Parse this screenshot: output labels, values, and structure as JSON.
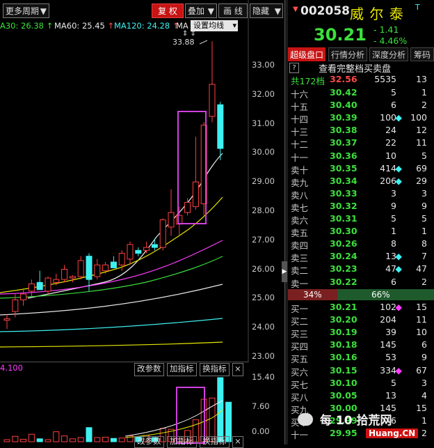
{
  "toolbar": {
    "period_label": "更多周期",
    "adjust_label": "复 权",
    "overlay_label": "叠加",
    "draw_label": "画 线",
    "hide_label": "隐藏",
    "set_ma_label": "设置均线"
  },
  "ma_legend": [
    {
      "label": "A30: 26.38",
      "arrow": "↑",
      "color": "#3be03b"
    },
    {
      "label": "MA60: 25.45",
      "arrow": "↑",
      "color": "#e8e8e8"
    },
    {
      "label": "MA120: 24.28",
      "arrow": "↑",
      "color": "#3ef0f0"
    },
    {
      "label": "MA",
      "arrow": "",
      "color": "#e8e8e8"
    }
  ],
  "price_axis": [
    "33.00",
    "32.00",
    "31.00",
    "30.00",
    "29.00",
    "28.00",
    "27.00",
    "26.00",
    "25.00",
    "24.00",
    "23.00"
  ],
  "peak_label": "33.88",
  "volume_axis": [
    "15.40",
    "7.60",
    "0.00"
  ],
  "indicator": {
    "value_label": "4.100",
    "change_params_1": "改参数",
    "add_indicator_1": "加指标",
    "switch_indicator_1": "换指标",
    "close_1": "×",
    "change_params_2": "改参数",
    "add_indicator_2": "加指标",
    "switch_indicator_2": "换指标",
    "close_2": "×"
  },
  "stock": {
    "code": "002058",
    "name": "威 尔 泰",
    "price": "30.21",
    "change": "- 1.41",
    "change_pct": "- 4.46%",
    "price_color": "#3be03b",
    "small_mark": "T"
  },
  "tabs": [
    "超级盘口",
    "行情分析",
    "深度分析",
    "筹码分"
  ],
  "full_book_label": "查看完整档买卖盘",
  "help_icon": "?",
  "summary": {
    "label": "共172档",
    "price": "32.56",
    "volume": "5535",
    "count": "13"
  },
  "asks": [
    {
      "label": "十六",
      "price": "30.42",
      "vol": "5",
      "dot": "",
      "cnt": "1"
    },
    {
      "label": "十五",
      "price": "30.40",
      "vol": "6",
      "dot": "",
      "cnt": "2"
    },
    {
      "label": "十四",
      "price": "30.39",
      "vol": "100",
      "dot": "◆",
      "cnt": "100"
    },
    {
      "label": "十三",
      "price": "30.38",
      "vol": "24",
      "dot": "",
      "cnt": "12"
    },
    {
      "label": "十二",
      "price": "30.37",
      "vol": "22",
      "dot": "",
      "cnt": "11"
    },
    {
      "label": "十一",
      "price": "30.36",
      "vol": "10",
      "dot": "",
      "cnt": "5"
    },
    {
      "label": "卖十",
      "price": "30.35",
      "vol": "414",
      "dot": "◆",
      "cnt": "69"
    },
    {
      "label": "卖九",
      "price": "30.34",
      "vol": "206",
      "dot": "◆",
      "cnt": "29"
    },
    {
      "label": "卖八",
      "price": "30.33",
      "vol": "3",
      "dot": "",
      "cnt": "3"
    },
    {
      "label": "卖七",
      "price": "30.32",
      "vol": "9",
      "dot": "",
      "cnt": "9"
    },
    {
      "label": "卖六",
      "price": "30.31",
      "vol": "5",
      "dot": "",
      "cnt": "5"
    },
    {
      "label": "卖五",
      "price": "30.30",
      "vol": "1",
      "dot": "",
      "cnt": "1"
    },
    {
      "label": "卖四",
      "price": "30.26",
      "vol": "8",
      "dot": "",
      "cnt": "8"
    },
    {
      "label": "卖三",
      "price": "30.24",
      "vol": "13",
      "dot": "◆",
      "cnt": "7"
    },
    {
      "label": "卖二",
      "price": "30.23",
      "vol": "47",
      "dot": "◆",
      "cnt": "47"
    },
    {
      "label": "卖一",
      "price": "30.22",
      "vol": "6",
      "dot": "",
      "cnt": "2"
    }
  ],
  "ratio": {
    "sell": "34%",
    "buy": "66%"
  },
  "bids": [
    {
      "label": "买一",
      "price": "30.21",
      "vol": "102",
      "dot": "◆",
      "cnt": "15"
    },
    {
      "label": "买二",
      "price": "30.20",
      "vol": "204",
      "dot": "",
      "cnt": "11"
    },
    {
      "label": "买三",
      "price": "30.19",
      "vol": "39",
      "dot": "",
      "cnt": "10"
    },
    {
      "label": "买四",
      "price": "30.18",
      "vol": "145",
      "dot": "",
      "cnt": "6"
    },
    {
      "label": "买五",
      "price": "30.16",
      "vol": "53",
      "dot": "",
      "cnt": "9"
    },
    {
      "label": "买六",
      "price": "30.15",
      "vol": "334",
      "dot": "◆",
      "cnt": "67"
    },
    {
      "label": "买七",
      "price": "30.10",
      "vol": "5",
      "dot": "",
      "cnt": "3"
    },
    {
      "label": "买八",
      "price": "30.05",
      "vol": "13",
      "dot": "",
      "cnt": "4"
    },
    {
      "label": "买九",
      "price": "30.00",
      "vol": "145",
      "dot": "",
      "cnt": "15"
    },
    {
      "label": "买十",
      "price": "29.99",
      "vol": "6",
      "dot": "",
      "cnt": "1"
    },
    {
      "label": "十一",
      "price": "29.95",
      "vol": "23",
      "dot": "",
      "cnt": "2"
    }
  ],
  "watermark": "每 10 拾荒网",
  "watermark_url": "Huang.CN",
  "chart_data": {
    "type": "candlestick",
    "price_ylim": [
      23,
      34
    ],
    "candles": [
      {
        "o": 24.3,
        "h": 24.5,
        "l": 24.0,
        "c": 24.35
      },
      {
        "o": 24.6,
        "h": 25.2,
        "l": 24.4,
        "c": 25.0
      },
      {
        "o": 25.0,
        "h": 25.4,
        "l": 24.8,
        "c": 25.2
      },
      {
        "o": 25.3,
        "h": 25.7,
        "l": 25.1,
        "c": 25.55
      },
      {
        "o": 25.6,
        "h": 26.0,
        "l": 25.4,
        "c": 25.35
      },
      {
        "o": 25.3,
        "h": 25.8,
        "l": 25.2,
        "c": 25.75
      },
      {
        "o": 25.6,
        "h": 25.9,
        "l": 25.5,
        "c": 25.7
      },
      {
        "o": 25.7,
        "h": 26.2,
        "l": 25.6,
        "c": 26.05
      },
      {
        "o": 25.75,
        "h": 25.85,
        "l": 25.6,
        "c": 25.8
      },
      {
        "o": 25.8,
        "h": 26.5,
        "l": 25.7,
        "c": 26.35
      },
      {
        "o": 26.5,
        "h": 26.6,
        "l": 25.3,
        "c": 25.7
      },
      {
        "o": 25.8,
        "h": 26.4,
        "l": 25.7,
        "c": 26.2
      },
      {
        "o": 26.0,
        "h": 26.3,
        "l": 25.9,
        "c": 26.2
      },
      {
        "o": 26.3,
        "h": 26.5,
        "l": 26.1,
        "c": 26.1
      },
      {
        "o": 26.2,
        "h": 26.7,
        "l": 26.0,
        "c": 26.6
      },
      {
        "o": 26.4,
        "h": 27.0,
        "l": 26.2,
        "c": 26.9
      },
      {
        "o": 26.7,
        "h": 26.8,
        "l": 26.5,
        "c": 26.6
      },
      {
        "o": 26.7,
        "h": 27.0,
        "l": 26.6,
        "c": 26.8
      },
      {
        "o": 26.9,
        "h": 27.1,
        "l": 26.7,
        "c": 26.8
      },
      {
        "o": 26.8,
        "h": 27.8,
        "l": 26.7,
        "c": 27.75
      },
      {
        "o": 27.5,
        "h": 28.8,
        "l": 27.2,
        "c": 28.0
      },
      {
        "o": 27.6,
        "h": 28.2,
        "l": 27.2,
        "c": 27.9
      },
      {
        "o": 28.0,
        "h": 28.5,
        "l": 27.9,
        "c": 28.35
      },
      {
        "o": 28.2,
        "h": 30.6,
        "l": 28.1,
        "c": 29.05
      },
      {
        "o": 28.3,
        "h": 31.1,
        "l": 27.9,
        "c": 31.0
      },
      {
        "o": 31.3,
        "h": 33.88,
        "l": 31.1,
        "c": 32.4
      },
      {
        "o": 31.7,
        "h": 31.8,
        "l": 29.8,
        "c": 30.2
      }
    ],
    "volume_ylim": [
      0,
      15.4
    ],
    "volumes": [
      0.5,
      1.3,
      0.6,
      1.8,
      0.7,
      0.5,
      2.4,
      1.4,
      0.7,
      1.0,
      3.4,
      1.0,
      1.1,
      0.8,
      0.9,
      1.4,
      1.2,
      1.5,
      1.0,
      3.2,
      3.0,
      0.7,
      2.7,
      5.3,
      10.2,
      10.5,
      15.4,
      9.5
    ]
  }
}
